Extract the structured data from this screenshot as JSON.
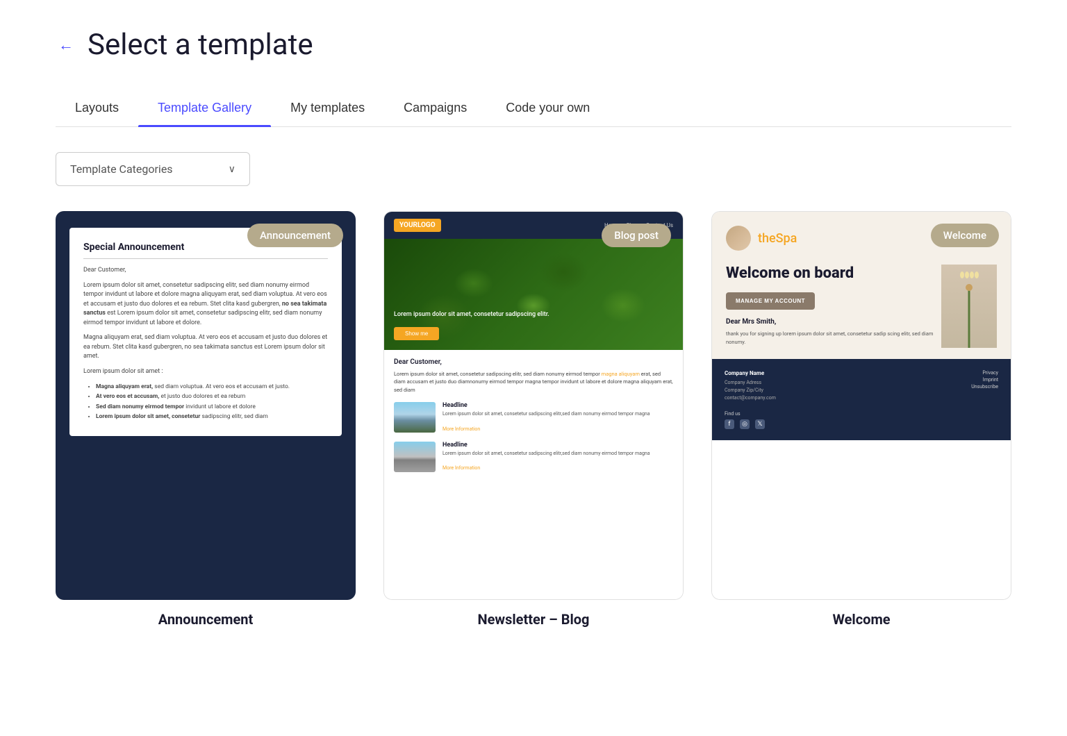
{
  "page": {
    "title": "Select a template",
    "back_label": "←"
  },
  "tabs": [
    {
      "id": "layouts",
      "label": "Layouts",
      "active": false
    },
    {
      "id": "template-gallery",
      "label": "Template Gallery",
      "active": true
    },
    {
      "id": "my-templates",
      "label": "My templates",
      "active": false
    },
    {
      "id": "campaigns",
      "label": "Campaigns",
      "active": false
    },
    {
      "id": "code-your-own",
      "label": "Code your own",
      "active": false
    }
  ],
  "filter": {
    "label": "Template Categories",
    "chevron": "∨"
  },
  "templates": [
    {
      "id": "announcement",
      "badge": "Announcement",
      "name": "Announcement",
      "card_type": "announcement"
    },
    {
      "id": "newsletter-blog",
      "badge": "Blog post",
      "name": "Newsletter – Blog",
      "card_type": "blog"
    },
    {
      "id": "welcome",
      "badge": "Welcome",
      "name": "Welcome",
      "card_type": "welcome"
    }
  ],
  "announcement_content": {
    "heading": "Special Announcement",
    "salutation": "Dear Customer,",
    "para1": "Lorem ipsum dolor sit amet, consetetur sadipscing elitr, sed diam nonumy eirmod tempor invidunt ut labore et dolore magna aliquyam erat, sed diam voluptua. At vero eos et accusam et justo duo dolores et ea rebum. Stet clita kasd gubergren,",
    "bold1": "no sea takimata sanctus",
    "para1b": "est Lorem ipsum dolor sit amet, consetetur sadipscing elitr, sed diam nonumy eirmod tempor invidunt ut labore et dolore.",
    "para2": "Magna aliquyam erat, sed diam voluptua. At vero eos et accusam et justo duo dolores et ea rebum. Stet clita kasd gubergren, no sea takimata sanctus est Lorem ipsum dolor sit amet.",
    "para3": "Lorem ipsum dolor sit amet :",
    "bullets": [
      {
        "bold": "Magna aliquyam erat,",
        "text": " sed diam voluptua. At vero eos et accusam et justo."
      },
      {
        "bold": "At vero eos et accusam,",
        "text": " et justo duo dolores et ea rebum"
      },
      {
        "bold": "Sed diam nonumy eirmod tempor",
        "text": " invidunt ut labore et dolore"
      },
      {
        "bold": "Lorem ipsum dolor sit amet, consetetur",
        "text": " sadipscing elitr, sed diam"
      }
    ]
  },
  "blog_content": {
    "logo": "YOURLOGO",
    "nav": [
      "Home",
      "Shop",
      "Contact Us"
    ],
    "hero_text": "Lorem ipsum dolor sit amet, consetetur sadipscing elitr.",
    "show_btn": "Show me",
    "salutation": "Dear Customer,",
    "intro": "Lorem ipsum dolor sit amet, consetetur sadipscing elitr, sed diam nonumy eirmod tempor",
    "intro_highlight": "magna aliquyam",
    "intro_rest": " erat, sed diam accusam et justo duo diamnonumy eirmod tempor magna tempor invidunt ut labore et dolore magna aliquyam erat, sed diam",
    "articles": [
      {
        "type": "mountains",
        "headline": "Headline",
        "body": "Lorem ipsum dolor sit amet, consetetur sadipscing elitr,sed diam nonumy eirmod tempor magna",
        "more": "More Information"
      },
      {
        "type": "road",
        "headline": "Headline",
        "body": "Lorem ipsum dolor sit amet, consetetur sadipscing elitr,sed diam nonumy eirmod tempor magna",
        "more": "More Information"
      }
    ]
  },
  "welcome_content": {
    "logo_text_before": "the",
    "logo_text_after": "Spa",
    "heading": "Welcome on board",
    "manage_btn": "MANAGE MY ACCOUNT",
    "dear": "Dear Mrs Smith,",
    "body": "thank you for signing up lorem ipsum dolor sit amet, consetetur sadip scing elitr, sed diam nonumy.",
    "footer": {
      "company_name": "Company Name",
      "company_address": "Company Adress",
      "company_zip": "Company Zip/City",
      "company_email": "contact@company.com",
      "find_us": "Find us",
      "links": [
        "Privacy",
        "Imprint",
        "Unsubscribe"
      ]
    }
  }
}
